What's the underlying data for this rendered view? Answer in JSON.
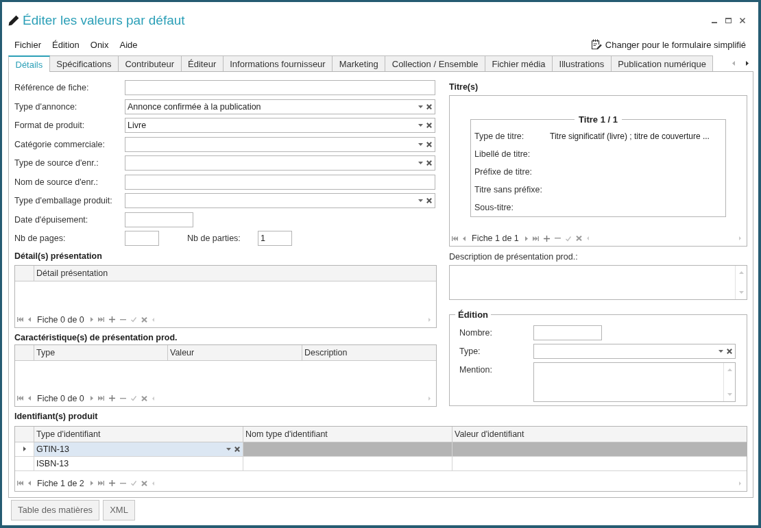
{
  "window": {
    "title": "Éditer les valeurs par défaut"
  },
  "menu": [
    "Fichier",
    "Édition",
    "Onix",
    "Aide"
  ],
  "simplified_form_link": "Changer pour le formulaire simplifié",
  "tabs": [
    {
      "label": "Détails",
      "selected": true
    },
    {
      "label": "Spécifications",
      "selected": false
    },
    {
      "label": "Contributeur",
      "selected": false
    },
    {
      "label": "Éditeur",
      "selected": false
    },
    {
      "label": "Informations fournisseur",
      "selected": false
    },
    {
      "label": "Marketing",
      "selected": false
    },
    {
      "label": "Collection / Ensemble",
      "selected": false
    },
    {
      "label": "Fichier média",
      "selected": false
    },
    {
      "label": "Illustrations",
      "selected": false
    },
    {
      "label": "Publication numérique",
      "selected": false
    }
  ],
  "fields": [
    {
      "kind": "text",
      "label": "Référence de fiche:"
    },
    {
      "kind": "combo",
      "label": "Type d'annonce:",
      "value": "Annonce confirmée à la publication"
    },
    {
      "kind": "combo",
      "label": "Format de produit:",
      "value": "Livre"
    },
    {
      "kind": "combo",
      "label": "Catégorie commerciale:"
    },
    {
      "kind": "combo",
      "label": "Type de source d'enr.:"
    },
    {
      "kind": "text",
      "label": "Nom de source d'enr.:"
    },
    {
      "kind": "combo",
      "label": "Type d'emballage produit:"
    },
    {
      "kind": "date",
      "label": "Date d'épuisement:"
    },
    {
      "kind": "pair",
      "items": [
        {
          "label": "Nb de pages:"
        },
        {
          "label": "Nb de parties:",
          "value": "1"
        }
      ]
    }
  ],
  "presentation_details": {
    "title": "Détail(s) présentation",
    "columns": [
      "Détail présentation"
    ],
    "record_counter": "Fiche 0 de 0"
  },
  "presentation_features": {
    "title": "Caractéristique(s) de présentation prod.",
    "columns": [
      "Type",
      "Valeur",
      "Description"
    ],
    "record_counter": "Fiche 0 de 0"
  },
  "titles": {
    "title": "Titre(s)",
    "group_title": "Titre 1 / 1",
    "fields": [
      {
        "label": "Type de titre:",
        "value": "Titre significatif (livre) ; titre de couverture ..."
      },
      {
        "label": "Libellé de titre:"
      },
      {
        "label": "Préfixe de titre:"
      },
      {
        "label": "Titre sans préfixe:"
      },
      {
        "label": "Sous-titre:"
      }
    ],
    "record_counter": "Fiche 1 de 1"
  },
  "presentation_description": {
    "label": "Description de présentation prod.:"
  },
  "edition": {
    "title": "Édition",
    "fields": [
      {
        "kind": "text",
        "label": "Nombre:"
      },
      {
        "kind": "combo",
        "label": "Type:"
      },
      {
        "kind": "textarea",
        "label": "Mention:"
      }
    ]
  },
  "identifiers": {
    "title": "Identifiant(s) produit",
    "columns": [
      "Type d'identifiant",
      "Nom type d'identifiant",
      "Valeur d'identifiant"
    ],
    "rows": [
      {
        "identifier_type": "GTIN-13",
        "selected": true
      },
      {
        "identifier_type": "ISBN-13",
        "selected": false
      }
    ],
    "record_counter": "Fiche 1 de 2"
  },
  "buttons": [
    "Table des matières",
    "XML"
  ]
}
